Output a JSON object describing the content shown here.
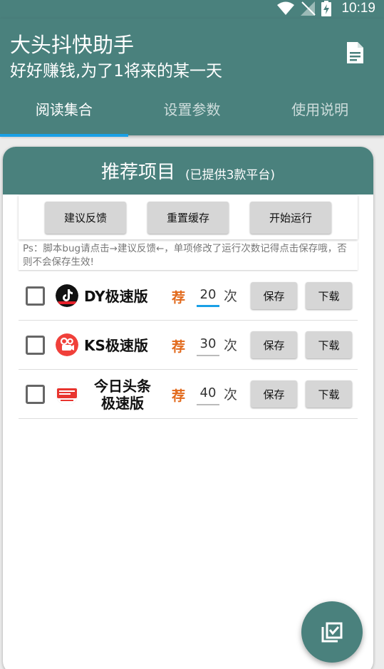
{
  "status_bar": {
    "time": "10:19"
  },
  "app": {
    "title": "大头抖快助手",
    "subtitle": "好好赚钱,为了1将来的某一天"
  },
  "tabs": [
    {
      "label": "阅读集合",
      "active": true
    },
    {
      "label": "设置参数",
      "active": false
    },
    {
      "label": "使用说明",
      "active": false
    }
  ],
  "card": {
    "title": "推荐项目",
    "subtitle": "(已提供3款平台)",
    "buttons": {
      "feedback": "建议反馈",
      "reset_cache": "重置缓存",
      "start": "开始运行"
    },
    "note": "Ps：脚本bug请点击→建议反馈←，单项修改了运行次数记得点击保存哦，否则不会保存生效!"
  },
  "items": [
    {
      "name": "DY极速版",
      "recommend": "荐",
      "count": "20",
      "unit": "次",
      "save": "保存",
      "download": "下载",
      "checked": false
    },
    {
      "name": "KS极速版",
      "recommend": "荐",
      "count": "30",
      "unit": "次",
      "save": "保存",
      "download": "下载",
      "checked": false
    },
    {
      "name_line1": "今日头条",
      "name_line2": "极速版",
      "recommend": "荐",
      "count": "40",
      "unit": "次",
      "save": "保存",
      "download": "下载",
      "checked": false
    }
  ],
  "colors": {
    "primary": "#4a817d",
    "tab_indicator": "#1aa0e6",
    "recommend": "#e26a1c"
  }
}
